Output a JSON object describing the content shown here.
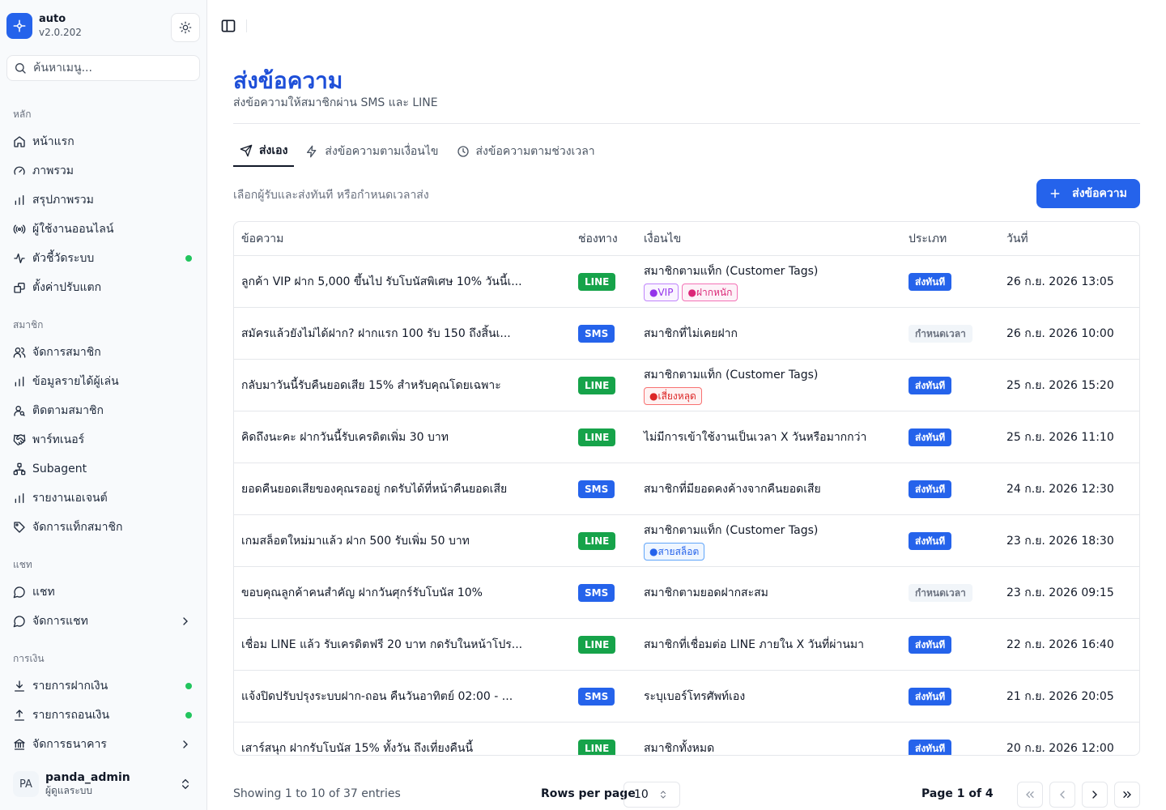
{
  "app": {
    "name": "auto",
    "version": "v2.0.202"
  },
  "search": {
    "placeholder": "ค้นหาเมนู..."
  },
  "sidebar": {
    "groups": [
      {
        "label": "หลัก",
        "items": [
          "หน้าแรก",
          "ภาพรวม",
          "สรุปภาพรวม",
          "ผู้ใช้งานออนไลน์",
          "ตัวชี้วัดระบบ",
          "ตั้งค่าปรับแตก"
        ]
      },
      {
        "label": "สมาชิก",
        "items": [
          "จัดการสมาชิก",
          "ข้อมูลรายได้ผู้เล่น",
          "ติดตามสมาชิก",
          "พาร์ทเนอร์",
          "Subagent",
          "รายงานเอเจนต์",
          "จัดการแท็กสมาชิก"
        ]
      },
      {
        "label": "แชท",
        "items": [
          "แชท",
          "จัดการแชท"
        ]
      },
      {
        "label": "การเงิน",
        "items": [
          "รายการฝากเงิน",
          "รายการถอนเงิน",
          "จัดการธนาคาร"
        ]
      }
    ]
  },
  "user": {
    "initials": "PA",
    "name": "panda_admin",
    "role": "ผู้ดูแลระบบ"
  },
  "page": {
    "title": "ส่งข้อความ",
    "subtitle": "ส่งข้อความให้สมาชิกผ่าน SMS และ LINE"
  },
  "tabs": [
    "ส่งเอง",
    "ส่งข้อความตามเงื่อนไข",
    "ส่งข้อความตามช่วงเวลา"
  ],
  "helper": "เลือกผู้รับและส่งทันที หรือกำหนดเวลาส่ง",
  "primary_button": "ส่งข้อความ",
  "table": {
    "headers": [
      "ข้อความ",
      "ช่องทาง",
      "เงื่อนไข",
      "ประเภท",
      "วันที่"
    ],
    "rows": [
      {
        "message": "ลูกค้า VIP ฝาก 5,000 ขึ้นไป รับโบนัสพิเศษ 10% วันนี้เ...",
        "channel": "LINE",
        "condition": "สมาชิกตามแท็ก (Customer Tags)",
        "tags": [
          {
            "text": "●VIP",
            "color": "purple"
          },
          {
            "text": "●ฝากหนัก",
            "color": "pink"
          }
        ],
        "type": "ส่งทันที",
        "date": "26 ก.ย. 2026 13:05"
      },
      {
        "message": "สมัครแล้วยังไม่ได้ฝาก? ฝากแรก 100 รับ 150 ถึงสิ้นเ...",
        "channel": "SMS",
        "condition": "สมาชิกที่ไม่เคยฝาก",
        "tags": [],
        "type": "กำหนดเวลา",
        "date": "26 ก.ย. 2026 10:00"
      },
      {
        "message": "กลับมาวันนี้รับคืนยอดเสีย 15% สำหรับคุณโดยเฉพาะ",
        "channel": "LINE",
        "condition": "สมาชิกตามแท็ก (Customer Tags)",
        "tags": [
          {
            "text": "●เสี่ยงหลุด",
            "color": "red"
          }
        ],
        "type": "ส่งทันที",
        "date": "25 ก.ย. 2026 15:20"
      },
      {
        "message": "คิดถึงนะคะ ฝากวันนี้รับเครดิตเพิ่ม 30 บาท",
        "channel": "LINE",
        "condition": "ไม่มีการเข้าใช้งานเป็นเวลา X วันหรือมากกว่า",
        "tags": [],
        "type": "ส่งทันที",
        "date": "25 ก.ย. 2026 11:10"
      },
      {
        "message": "ยอดคืนยอดเสียของคุณรออยู่ กดรับได้ที่หน้าคืนยอดเสีย",
        "channel": "SMS",
        "condition": "สมาชิกที่มียอดคงค้างจากคืนยอดเสีย",
        "tags": [],
        "type": "ส่งทันที",
        "date": "24 ก.ย. 2026 12:30"
      },
      {
        "message": "เกมสล็อตใหม่มาแล้ว ฝาก 500 รับเพิ่ม 50 บาท",
        "channel": "LINE",
        "condition": "สมาชิกตามแท็ก (Customer Tags)",
        "tags": [
          {
            "text": "●สายสล็อต",
            "color": "blue"
          }
        ],
        "type": "ส่งทันที",
        "date": "23 ก.ย. 2026 18:30"
      },
      {
        "message": "ขอบคุณลูกค้าคนสำคัญ ฝากวันศุกร์รับโบนัส 10%",
        "channel": "SMS",
        "condition": "สมาชิกตามยอดฝากสะสม",
        "tags": [],
        "type": "กำหนดเวลา",
        "date": "23 ก.ย. 2026 09:15"
      },
      {
        "message": "เชื่อม LINE แล้ว รับเครดิตฟรี 20 บาท กดรับในหน้าโปร...",
        "channel": "LINE",
        "condition": "สมาชิกที่เชื่อมต่อ LINE ภายใน X วันที่ผ่านมา",
        "tags": [],
        "type": "ส่งทันที",
        "date": "22 ก.ย. 2026 16:40"
      },
      {
        "message": "แจ้งปิดปรับปรุงระบบฝาก-ถอน คืนวันอาทิตย์ 02:00 - ...",
        "channel": "SMS",
        "condition": "ระบุเบอร์โทรศัพท์เอง",
        "tags": [],
        "type": "ส่งทันที",
        "date": "21 ก.ย. 2026 20:05"
      },
      {
        "message": "เสาร์สนุก ฝากรับโบนัส 15% ทั้งวัน ถึงเที่ยงคืนนี้",
        "channel": "LINE",
        "condition": "สมาชิกทั้งหมด",
        "tags": [],
        "type": "ส่งทันที",
        "date": "20 ก.ย. 2026 12:00"
      }
    ]
  },
  "footer": {
    "showing": "Showing 1 to 10 of 37 entries",
    "rows_per_page_label": "Rows per page",
    "rows_per_page": "10",
    "page_info": "Page 1 of 4"
  },
  "colors": {
    "primary": "#2563eb",
    "line": "#16a34a",
    "online": "#22c55e"
  }
}
